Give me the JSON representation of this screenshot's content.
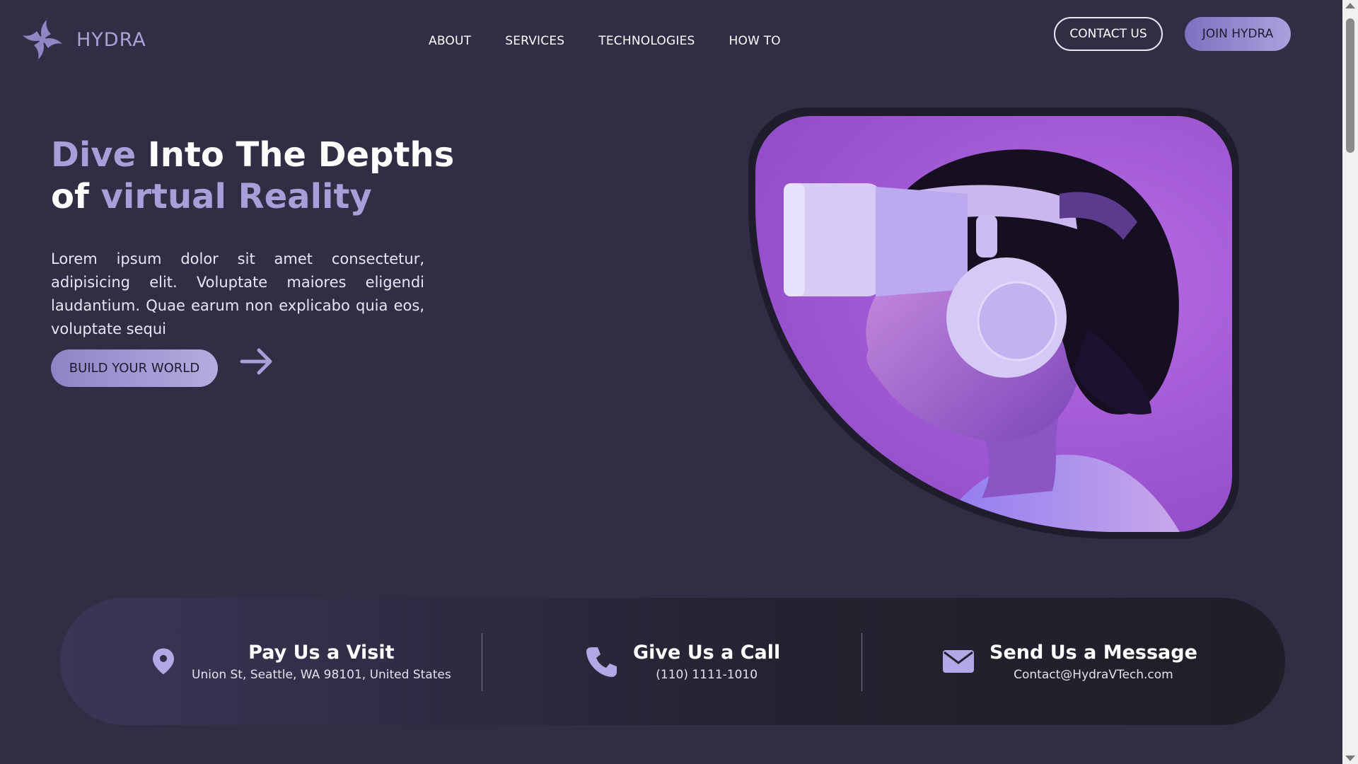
{
  "brand": {
    "name": "HYDRA"
  },
  "nav": {
    "items": [
      {
        "label": "ABOUT"
      },
      {
        "label": "SERVICES"
      },
      {
        "label": "TECHNOLOGIES"
      },
      {
        "label": "HOW TO"
      }
    ]
  },
  "header": {
    "contact_label": "CONTACT US",
    "join_label": "JOIN HYDRA"
  },
  "hero": {
    "title_word1": "Dive",
    "title_rest_line1": " Into The Depths",
    "title_of": "of ",
    "title_word_virtual": "virtual",
    "title_word_reality": " Reality",
    "description": "Lorem ipsum dolor sit amet consectetur, adipisicing elit. Voluptate maiores eligendi laudantium. Quae earum non explicabo quia eos, voluptate sequi",
    "cta_label": "BUILD YOUR WORLD",
    "image_icon": "vr-headset-person-image"
  },
  "contact": {
    "visit": {
      "title": "Pay Us a Visit",
      "detail": "Union St, Seattle, WA 98101, United States",
      "icon": "location-pin-icon"
    },
    "call": {
      "title": "Give Us a Call",
      "detail": "(110) 1111-1010",
      "icon": "phone-icon"
    },
    "message": {
      "title": "Send Us a Message",
      "detail": "Contact@HydraVTech.com",
      "icon": "envelope-icon"
    }
  },
  "colors": {
    "background": "#302d45",
    "accent": "#a79fd7",
    "button_gradient_start": "#7f70c0",
    "button_gradient_end": "#aba1dd",
    "image_purple": "#a85ddb"
  }
}
